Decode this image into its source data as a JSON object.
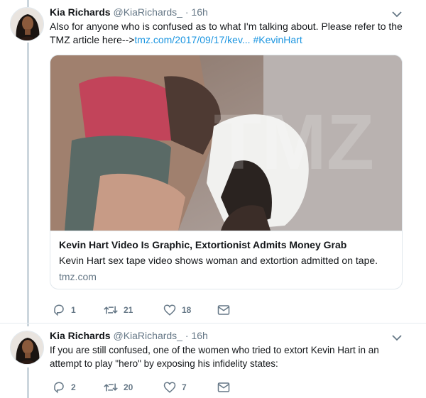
{
  "tweets": [
    {
      "author": {
        "name": "Kia Richards",
        "handle": "@KiaRichards_"
      },
      "time": "16h",
      "separator": "·",
      "text_1": "Also for anyone who is confused as to what I'm talking about. Please refer to the TMZ article here-->",
      "link_text": "tmz.com/2017/09/17/kev...",
      "hashtag": "#KevinHart",
      "card": {
        "title": "Kevin Hart Video Is Graphic, Extortionist Admits Money Grab",
        "description": "Kevin Hart sex tape video shows woman and extortion admitted on tape.",
        "domain": "tmz.com"
      },
      "stats": {
        "replies": "1",
        "retweets": "21",
        "likes": "18"
      }
    },
    {
      "author": {
        "name": "Kia Richards",
        "handle": "@KiaRichards_"
      },
      "time": "16h",
      "separator": "·",
      "text": "If you are still confused, one of the women who tried to extort Kevin Hart in an attempt to play \"hero\" by exposing his infidelity states:",
      "stats": {
        "replies": "2",
        "retweets": "20",
        "likes": "7"
      }
    }
  ],
  "icons": [
    "reply-icon",
    "retweet-icon",
    "like-icon",
    "direct-message-icon",
    "chevron-down-icon"
  ],
  "colors": {
    "link": "#1b95e0",
    "secondary_text": "#657786",
    "thread_line": "#ccd6dd",
    "border": "#e1e8ed"
  }
}
